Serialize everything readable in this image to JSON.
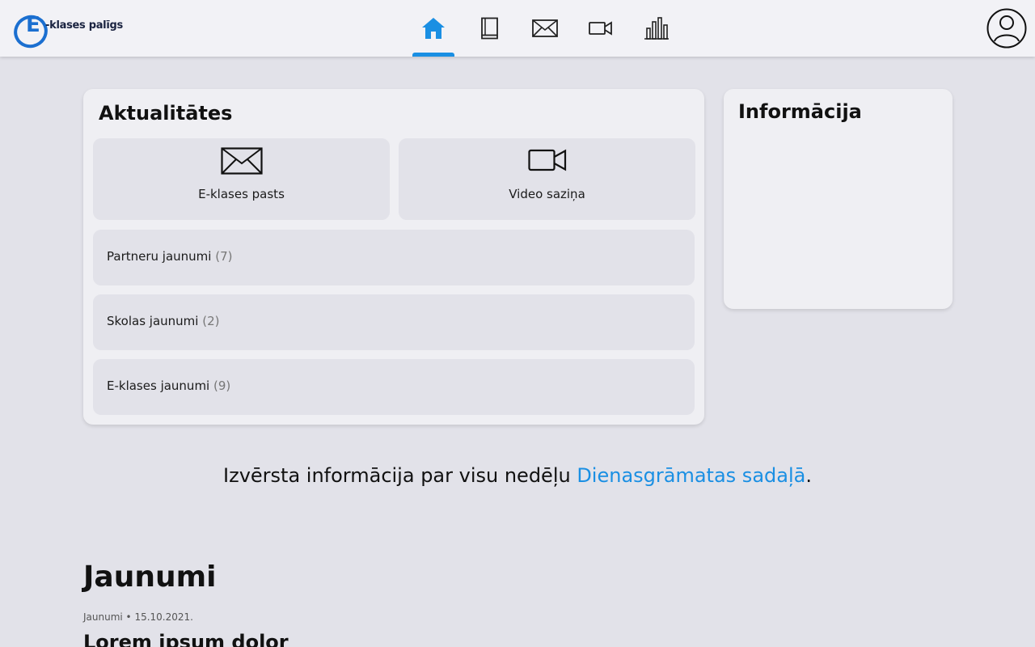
{
  "header": {
    "logo_letter": "E",
    "logo_text": "-klases palīgs",
    "nav": [
      {
        "icon": "home-icon",
        "active": true
      },
      {
        "icon": "book-icon",
        "active": false
      },
      {
        "icon": "mail-icon",
        "active": false
      },
      {
        "icon": "video-camera-icon",
        "active": false
      },
      {
        "icon": "bar-chart-icon",
        "active": false
      }
    ],
    "profile_icon": "user-avatar-icon"
  },
  "colors": {
    "accent": "#1a8fe3",
    "page_bg": "#e2e2e9",
    "card_bg": "#efeff3",
    "tile_bg": "#e2e2e9"
  },
  "updates": {
    "title": "Aktualitātes",
    "tiles": [
      {
        "label": "E-klases pasts",
        "icon": "envelope-icon"
      },
      {
        "label": "Video saziņa",
        "icon": "video-camera-icon"
      }
    ],
    "rows": [
      {
        "label": "Partneru jaunumi",
        "count": "(7)"
      },
      {
        "label": "Skolas jaunumi",
        "count": "(2)"
      },
      {
        "label": "E-klases jaunumi",
        "count": "(9)"
      }
    ]
  },
  "info": {
    "title": "Informācija"
  },
  "week_note": {
    "text": "Izvērsta informācija par visu nedēļu ",
    "link": "Dienasgrāmatas sadaļā",
    "suffix": "."
  },
  "news": {
    "heading": "Jaunumi",
    "meta": "Jaunumi • 15.10.2021.",
    "first_title": "Lorem ipsum dolor"
  }
}
